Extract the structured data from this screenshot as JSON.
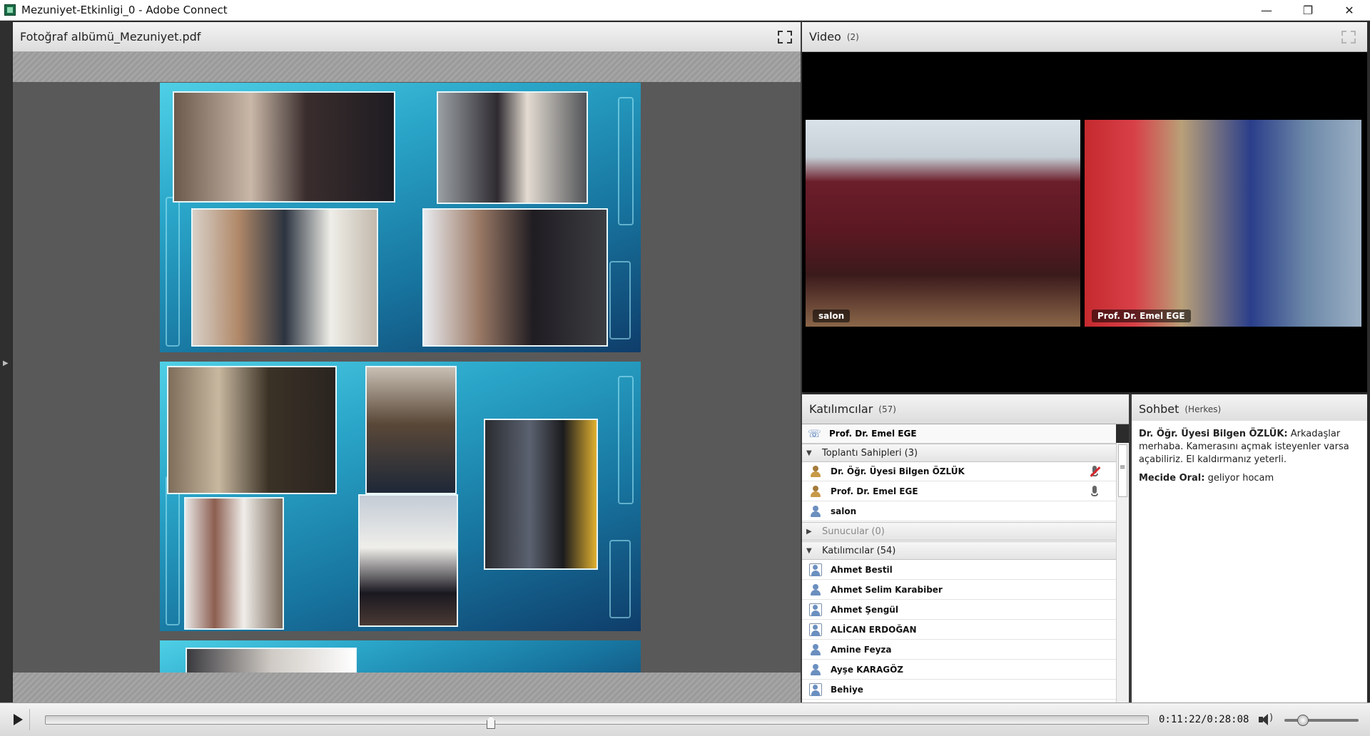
{
  "window": {
    "title": "Mezuniyet-Etkinligi_0 - Adobe Connect",
    "controls": [
      "—",
      "❐",
      "✕"
    ]
  },
  "share_pod": {
    "title": "Fotoğraf albümü_Mezuniyet.pdf"
  },
  "video_pod": {
    "title": "Video",
    "count": "(2)",
    "feeds": [
      {
        "label": "salon"
      },
      {
        "label": "Prof. Dr. Emel EGE"
      }
    ]
  },
  "attendees_pod": {
    "title": "Katılımcılar",
    "count": "(57)",
    "presenter": "Prof. Dr. Emel EGE",
    "hosts_group": "Toplantı Sahipleri (3)",
    "hosts": [
      {
        "name": "Dr. Öğr. Üyesi Bilgen ÖZLÜK",
        "status": "mic-muted"
      },
      {
        "name": "Prof. Dr. Emel EGE",
        "status": "mic-on"
      },
      {
        "name": "salon",
        "status": ""
      }
    ],
    "presenters_group": "Sunucular (0)",
    "participants_group": "Katılımcılar (54)",
    "participants": [
      "Ahmet Bestil",
      "Ahmet Selim Karabiber",
      "Ahmet Şengül",
      "ALİCAN ERDOĞAN",
      "Amine Feyza",
      "Ayşe KARAGÖZ",
      "Behiye"
    ]
  },
  "chat_pod": {
    "title": "Sohbet",
    "scope": "(Herkes)",
    "messages": [
      {
        "sender": "Dr. Öğr. Üyesi Bilgen ÖZLÜK:",
        "text": "Arkadaşlar merhaba. Kamerasını açmak isteyenler varsa açabiliriz. El kaldırmanız yeterli."
      },
      {
        "sender": "Mecide Oral:",
        "text": "geliyor hocam"
      }
    ]
  },
  "playback": {
    "time": "0:11:22/0:28:08",
    "progress": 0.404,
    "volume": 0.25
  }
}
